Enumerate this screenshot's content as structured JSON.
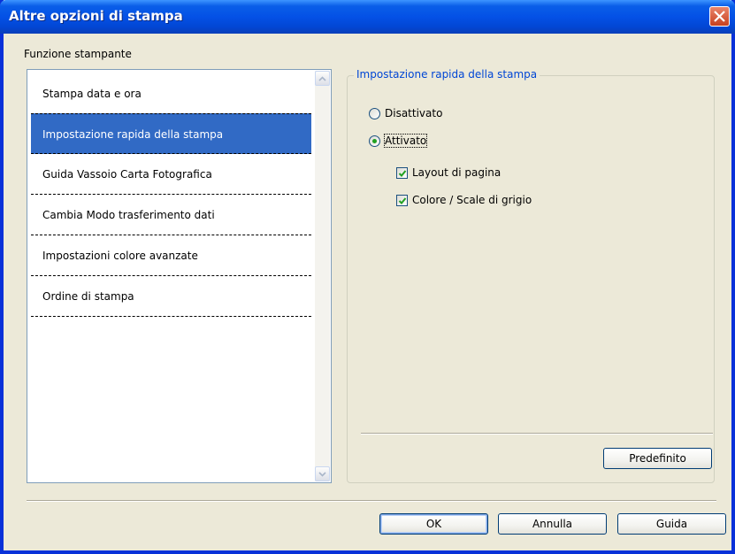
{
  "window": {
    "title": "Altre opzioni di stampa"
  },
  "printer_function": {
    "caption": "Funzione stampante",
    "items": [
      {
        "label": "Stampa data e ora"
      },
      {
        "label": "Impostazione rapida della stampa",
        "selected": true
      },
      {
        "label": "Guida Vassoio Carta Fotografica"
      },
      {
        "label": "Cambia Modo trasferimento dati"
      },
      {
        "label": "Impostazioni colore avanzate"
      },
      {
        "label": "Ordine di stampa"
      }
    ]
  },
  "quick_print_setup": {
    "legend": "Impostazione rapida della stampa",
    "options": [
      {
        "label": "Disattivato",
        "checked": false
      },
      {
        "label": "Attivato",
        "checked": true
      }
    ],
    "checkboxes": [
      {
        "label": "Layout di pagina",
        "checked": true
      },
      {
        "label": "Colore / Scale di grigio",
        "checked": true
      }
    ],
    "default_button": "Predefinito"
  },
  "buttons": {
    "ok": "OK",
    "cancel": "Annulla",
    "help": "Guida"
  },
  "colors": {
    "selection": "#316ac5",
    "titlebar": "#0451e6",
    "legend": "#0046d5"
  }
}
